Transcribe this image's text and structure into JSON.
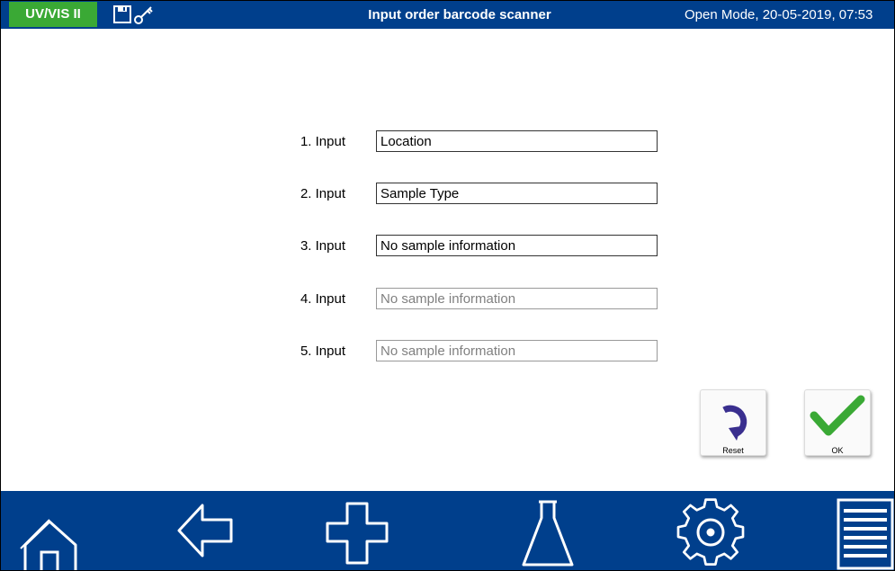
{
  "header": {
    "app_name": "UV/VIS II",
    "title": "Input order barcode scanner",
    "status": "Open Mode, 20-05-2019, 07:53",
    "icons": [
      "save-icon",
      "key-icon"
    ]
  },
  "form": {
    "rows": [
      {
        "label": "1. Input",
        "value": "Location",
        "placeholder": ""
      },
      {
        "label": "2. Input",
        "value": "Sample Type",
        "placeholder": ""
      },
      {
        "label": "3. Input",
        "value": "No sample information",
        "placeholder": ""
      },
      {
        "label": "4. Input",
        "value": "",
        "placeholder": "No sample information"
      },
      {
        "label": "5. Input",
        "value": "",
        "placeholder": "No sample information"
      }
    ]
  },
  "actions": {
    "reset_label": "Reset",
    "ok_label": "OK"
  },
  "footer": {
    "nav": [
      "home-icon",
      "back-icon",
      "add-icon",
      "flask-icon",
      "settings-icon",
      "menu-icon"
    ]
  },
  "colors": {
    "header_bg": "#003f8c",
    "app_badge": "#3aa935",
    "reset_arrow": "#3a2f8f",
    "ok_check": "#3aa935"
  }
}
